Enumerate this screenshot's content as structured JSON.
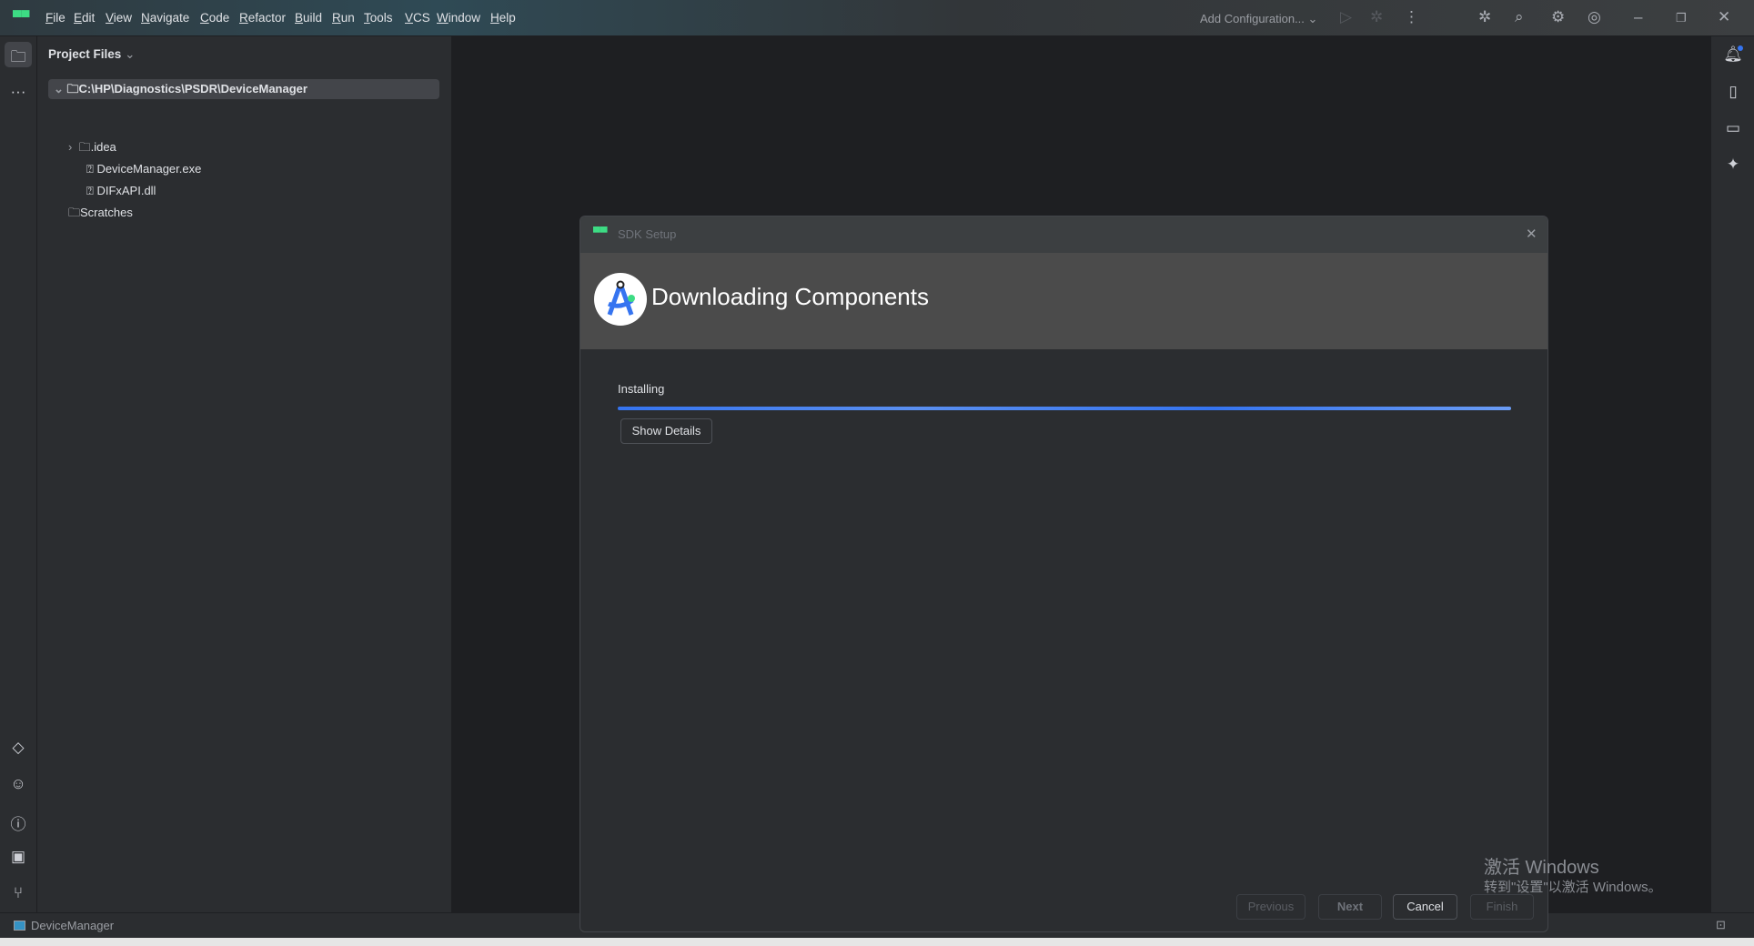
{
  "menu": [
    "File",
    "Edit",
    "View",
    "Navigate",
    "Code",
    "Refactor",
    "Build",
    "Run",
    "Tools",
    "VCS",
    "Window",
    "Help"
  ],
  "toolbar": {
    "run_config": "Add Configuration..."
  },
  "project": {
    "title": "Project Files",
    "root": "C:\\HP\\Diagnostics\\PSDR\\DeviceManager",
    "items": [
      ".idea",
      "DeviceManager.exe",
      "DIFxAPI.dll"
    ],
    "scratches": "Scratches"
  },
  "status": {
    "project": "DeviceManager"
  },
  "dialog": {
    "title": "SDK Setup",
    "heading": "Downloading Components",
    "status": "Installing",
    "progress": 100,
    "show_details": "Show Details",
    "previous": "Previous",
    "next": "Next",
    "cancel": "Cancel",
    "finish": "Finish"
  },
  "watermark": {
    "line1": "激活 Windows",
    "line2": "转到\"设置\"以激活 Windows。"
  },
  "colors": {
    "accent": "#3574f0",
    "android": "#3ddc84"
  }
}
